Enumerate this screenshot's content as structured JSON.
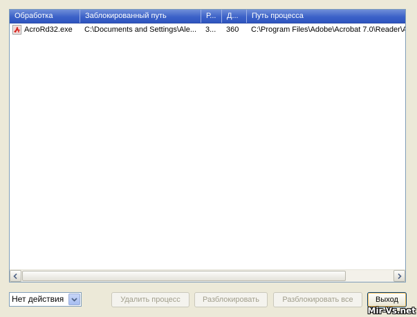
{
  "table": {
    "columns": [
      {
        "label": "Обработка"
      },
      {
        "label": "Заблокированный путь"
      },
      {
        "label": "Р..."
      },
      {
        "label": "Д..."
      },
      {
        "label": "Путь процесса"
      }
    ],
    "rows": [
      {
        "process": "AcroRd32.exe",
        "locked_path": "C:\\Documents and Settings\\Ale...",
        "pid_short": "3...",
        "handle": "360",
        "process_path": "C:\\Program Files\\Adobe\\Acrobat 7.0\\Reader\\A",
        "icon": "pdf-icon"
      }
    ]
  },
  "footer": {
    "action_select_value": "Нет действия",
    "buttons": {
      "delete_process": "Удалить процесс",
      "unlock": "Разблокировать",
      "unlock_all": "Разблокировать все",
      "exit": "Выход"
    }
  },
  "watermark": "Mir-Vs.net",
  "colors": {
    "header_bg": "#3c62c8",
    "window_bg": "#ece9d8",
    "list_border": "#7f9db9",
    "disabled_text": "#a19e8c",
    "pdf_red": "#d5261f"
  }
}
